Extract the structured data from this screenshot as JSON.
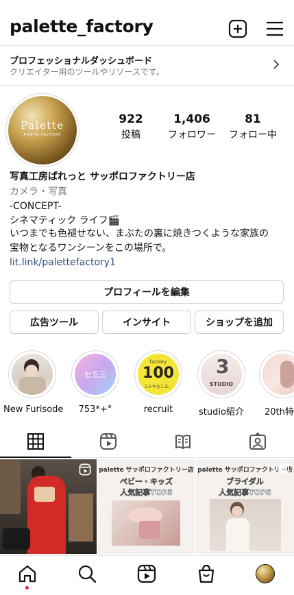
{
  "header": {
    "username": "palette_factory"
  },
  "dashboard": {
    "title": "プロフェッショナルダッシュボード",
    "subtitle": "クリエイター用のツールやリソースです。"
  },
  "avatar": {
    "brand": "Palette",
    "brand_sub": "PHOTO FACTORY"
  },
  "stats": [
    {
      "value": "922",
      "label": "投稿"
    },
    {
      "value": "1,406",
      "label": "フォロワー"
    },
    {
      "value": "81",
      "label": "フォロー中"
    }
  ],
  "bio": {
    "name": "写真工房ぱれっと サッポロファクトリー店",
    "category": "カメラ・写真",
    "line1": "-CONCEPT-",
    "line2": "シネマティック ライフ🎬",
    "line3": "いつまでも色褪せない、まぶたの裏に焼きつくような家族の",
    "line4": "宝物となるワンシーンをこの場所で。",
    "link": "lit.link/palettefactory1"
  },
  "buttons": {
    "edit_profile": "プロフィールを編集",
    "ad_tools": "広告ツール",
    "insights": "インサイト",
    "add_shop": "ショップを追加"
  },
  "highlights": [
    {
      "label": "New Furisode"
    },
    {
      "label": "753*+°",
      "inner": "七五三"
    },
    {
      "label": "recruit",
      "inner_top": "factory",
      "inner_num": "100",
      "inner_bot": "ステキなこと。"
    },
    {
      "label": "studio紹介",
      "inner": "STUDIO"
    },
    {
      "label": "20th特"
    }
  ],
  "posts": [
    {
      "type": "reel"
    },
    {
      "brand": "palette サッポロファクトリー店",
      "title": "ベビー・キッズ",
      "subtitle": "人気記事TOP5"
    },
    {
      "brand": "palette サッポロファクトリー店",
      "title": "ブライダル",
      "subtitle": "人気記事TOP5"
    }
  ],
  "colors": {
    "link": "#2c4f7c",
    "notification_dot": "#ee1d52",
    "border": "#cfcfcf"
  }
}
